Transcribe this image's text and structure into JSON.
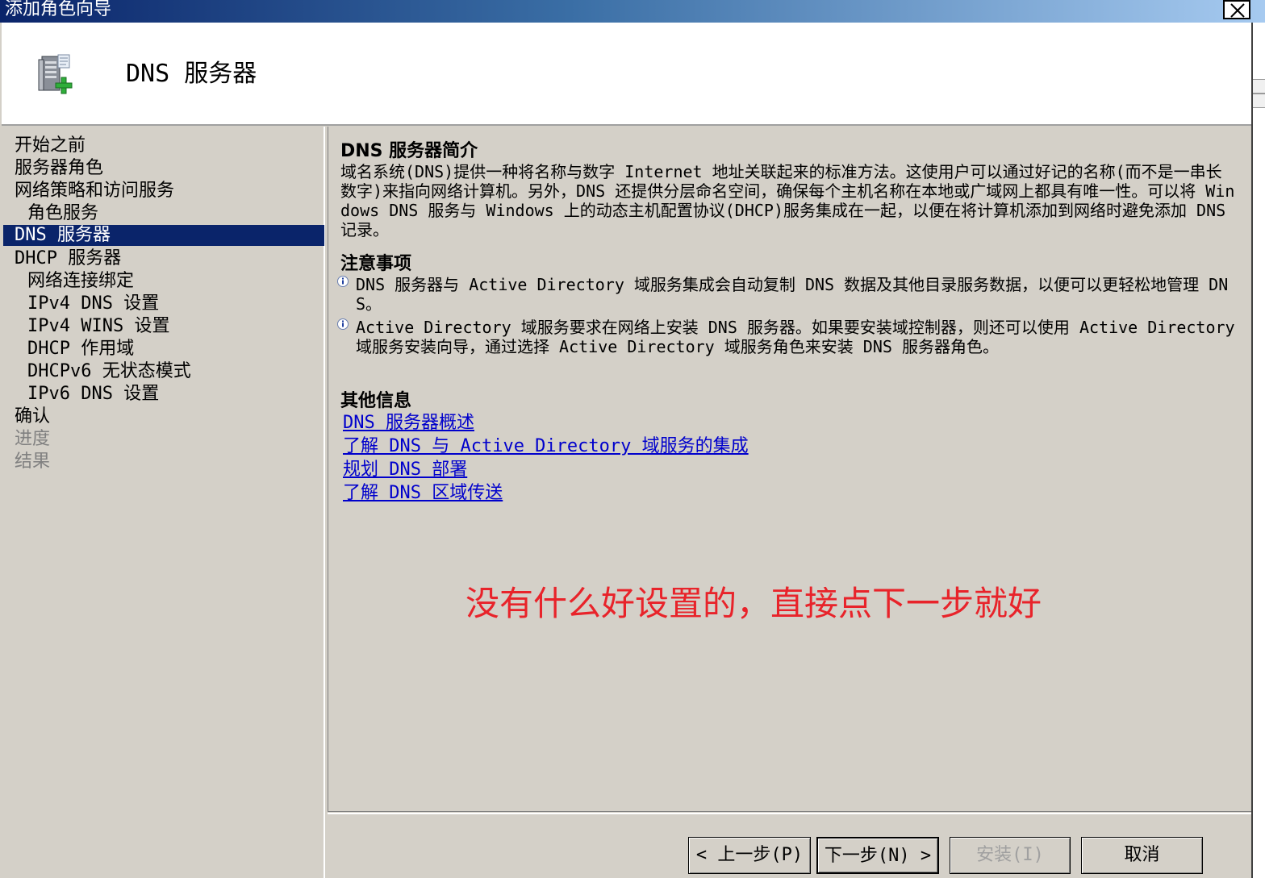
{
  "window": {
    "title": "添加角色向导",
    "close_symbol": "✕"
  },
  "header": {
    "title": "DNS  服务器",
    "icon": "server-add-icon"
  },
  "sidebar": {
    "items": [
      {
        "label": "开始之前",
        "state": "normal",
        "level": 0
      },
      {
        "label": "服务器角色",
        "state": "normal",
        "level": 0
      },
      {
        "label": "网络策略和访问服务",
        "state": "normal",
        "level": 0
      },
      {
        "label": "角色服务",
        "state": "normal",
        "level": 1
      },
      {
        "label": "DNS  服务器",
        "state": "active",
        "level": 0
      },
      {
        "label": "DHCP  服务器",
        "state": "normal",
        "level": 0
      },
      {
        "label": "网络连接绑定",
        "state": "normal",
        "level": 1
      },
      {
        "label": "IPv4  DNS  设置",
        "state": "normal",
        "level": 1
      },
      {
        "label": "IPv4  WINS  设置",
        "state": "normal",
        "level": 1
      },
      {
        "label": "DHCP  作用域",
        "state": "normal",
        "level": 1
      },
      {
        "label": "DHCPv6  无状态模式",
        "state": "normal",
        "level": 1
      },
      {
        "label": "IPv6  DNS  设置",
        "state": "normal",
        "level": 1
      },
      {
        "label": "确认",
        "state": "normal",
        "level": 0
      },
      {
        "label": "进度",
        "state": "disabled",
        "level": 0
      },
      {
        "label": "结果",
        "state": "disabled",
        "level": 0
      }
    ]
  },
  "content": {
    "intro_title": "DNS  服务器简介",
    "intro_text": "域名系统(DNS)提供一种将名称与数字 Internet 地址关联起来的标准方法。这使用户可以通过好记的名称(而不是一串长数字)来指向网络计算机。另外，DNS 还提供分层命名空间，确保每个主机名称在本地或广域网上都具有唯一性。可以将 Windows DNS 服务与 Windows 上的动态主机配置协议(DHCP)服务集成在一起，以便在将计算机添加到网络时避免添加 DNS 记录。",
    "notes_title": "注意事项",
    "notes": [
      "DNS 服务器与 Active Directory 域服务集成会自动复制 DNS 数据及其他目录服务数据，以便可以更轻松地管理 DNS。",
      "Active Directory 域服务要求在网络上安装 DNS 服务器。如果要安装域控制器，则还可以使用 Active Directory 域服务安装向导，通过选择 Active Directory 域服务角色来安装 DNS 服务器角色。"
    ],
    "more_title": "其他信息",
    "links": [
      "DNS  服务器概述",
      "了解  DNS  与  Active Directory  域服务的集成",
      "规划  DNS  部署",
      "了解  DNS  区域传送"
    ],
    "annotation": "没有什么好设置的，直接点下一步就好",
    "annotation_color": "#e8232a"
  },
  "buttons": {
    "back": "< 上一步(P)",
    "next": "下一步(N) >",
    "install": "安装(I)",
    "cancel": "取消"
  },
  "colors": {
    "selection": "#0a246a",
    "link": "#0000cc",
    "background": "#d4d0c8"
  }
}
